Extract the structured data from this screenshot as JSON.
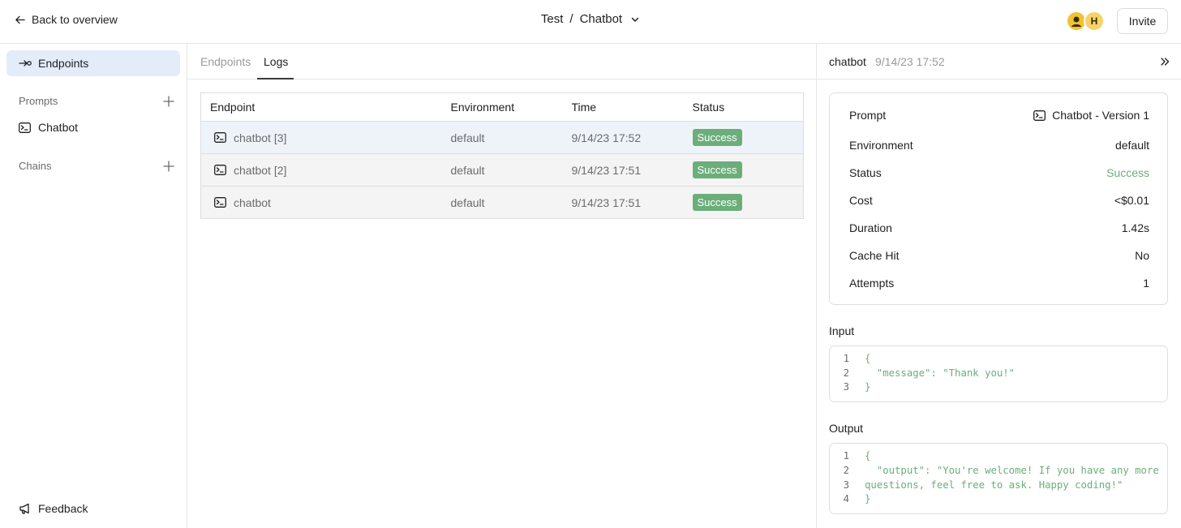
{
  "header": {
    "back_label": "Back to overview",
    "project": "Test",
    "separator": "/",
    "app": "Chatbot",
    "avatars": [
      "",
      "H"
    ],
    "invite_label": "Invite"
  },
  "sidebar": {
    "endpoints_label": "Endpoints",
    "prompts_heading": "Prompts",
    "prompt_item": "Chatbot",
    "chains_heading": "Chains",
    "feedback_label": "Feedback"
  },
  "main": {
    "tabs": [
      {
        "label": "Endpoints",
        "active": false
      },
      {
        "label": "Logs",
        "active": true
      }
    ],
    "columns": [
      "Endpoint",
      "Environment",
      "Time",
      "Status"
    ],
    "rows": [
      {
        "endpoint": "chatbot [3]",
        "environment": "default",
        "time": "9/14/23 17:52",
        "status": "Success"
      },
      {
        "endpoint": "chatbot [2]",
        "environment": "default",
        "time": "9/14/23 17:51",
        "status": "Success"
      },
      {
        "endpoint": "chatbot",
        "environment": "default",
        "time": "9/14/23 17:51",
        "status": "Success"
      }
    ]
  },
  "panel": {
    "title": "chatbot",
    "timestamp": "9/14/23 17:52",
    "details": [
      {
        "label": "Prompt",
        "value": "Chatbot - Version 1"
      },
      {
        "label": "Environment",
        "value": "default"
      },
      {
        "label": "Status",
        "value": "Success"
      },
      {
        "label": "Cost",
        "value": "<$0.01"
      },
      {
        "label": "Duration",
        "value": "1.42s"
      },
      {
        "label": "Cache Hit",
        "value": "No"
      },
      {
        "label": "Attempts",
        "value": "1"
      }
    ],
    "input_label": "Input",
    "input_lines": [
      "{",
      "  \"message\": \"Thank you!\"",
      "}"
    ],
    "output_label": "Output",
    "output_lines": [
      "{",
      "  \"output\": \"You're welcome! If you have any more",
      "questions, feel free to ask. Happy coding!\"",
      "}"
    ]
  },
  "colors": {
    "accent_active_bg": "#e3edf9",
    "success": "#6cae7a",
    "border": "#dedede"
  }
}
